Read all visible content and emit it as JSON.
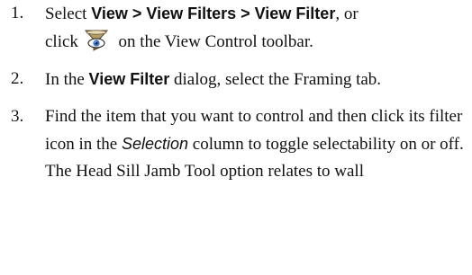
{
  "steps": [
    {
      "number": "1.",
      "parts": {
        "select": "Select ",
        "menu_path": "View > View Filters > View Filter",
        "or": ", or",
        "click": "click",
        "after_icon": "on the View Control toolbar."
      },
      "icon": "view-filter-funnel-eye-icon"
    },
    {
      "number": "2.",
      "parts": {
        "in_the": "In the ",
        "dialog_name": "View Filter",
        "rest": " dialog, select the Framing tab."
      }
    },
    {
      "number": "3.",
      "parts": {
        "before": "Find the item that you want to control and then click its filter icon in the ",
        "column_name": "Selection",
        "after": " column to toggle selectability on or off. The Head Sill Jamb Tool option relates to wall"
      }
    }
  ]
}
